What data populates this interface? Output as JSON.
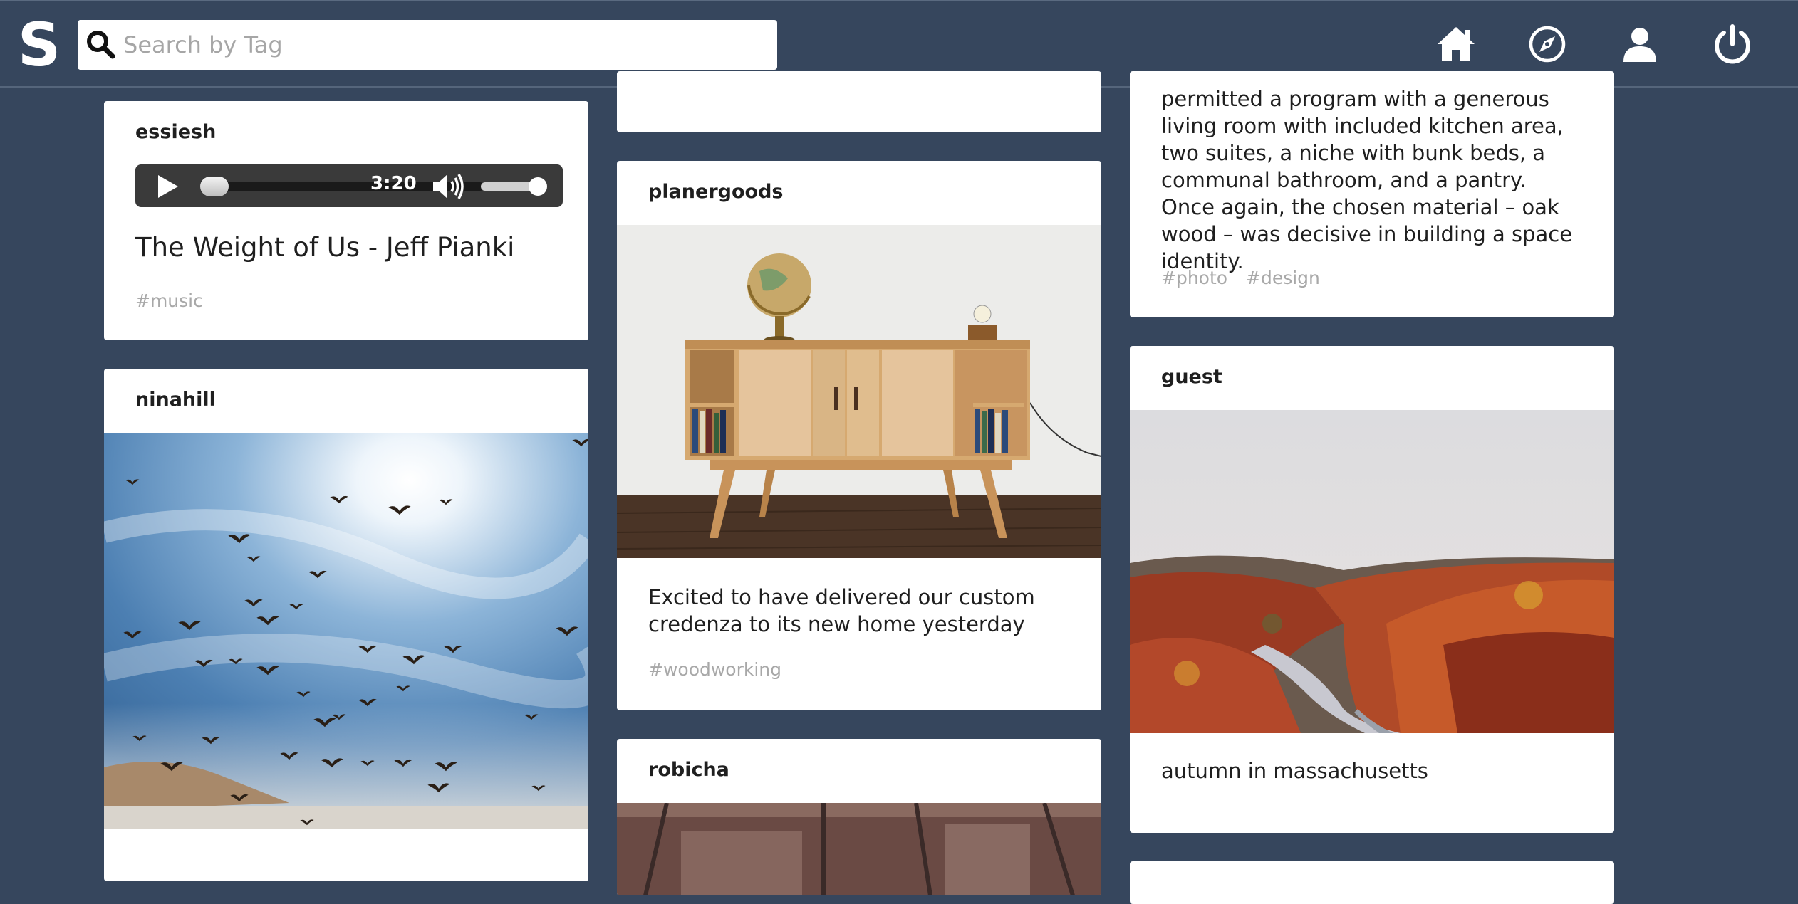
{
  "header": {
    "logo_letter": "S",
    "search_placeholder": "Search by Tag",
    "nav": [
      "home-icon",
      "compass-icon",
      "user-icon",
      "power-icon"
    ]
  },
  "posts": {
    "essiesh": {
      "user": "essiesh",
      "audio_time": "3:20",
      "audio_progress": 0.02,
      "audio_volume": 1.0,
      "title": "The Weight of Us - Jeff Pianki",
      "tags": [
        "#music"
      ]
    },
    "ninahill": {
      "user": "ninahill",
      "image": "birds-in-sky"
    },
    "partial_top": {
      "user": ""
    },
    "planergoods": {
      "user": "planergoods",
      "image": "wooden-credenza-with-globe",
      "caption": "Excited to have delivered our custom credenza to its new home yesterday",
      "tags": [
        "#woodworking"
      ]
    },
    "robicha": {
      "user": "robicha",
      "image": "train-interior"
    },
    "design_post": {
      "caption": "permitted a program with a generous living room with included kitchen area, two suites, a niche with bunk beds, a communal bathroom, and a pantry. Once again, the chosen material – oak wood – was decisive in building a space identity.",
      "tags": [
        "#photo",
        "#design"
      ]
    },
    "guest": {
      "user": "guest",
      "image": "autumn-river-valley",
      "caption": "autumn in massachusetts"
    }
  },
  "colors": {
    "background": "#36465d",
    "card": "#ffffff",
    "tag": "#a8a8a8"
  }
}
